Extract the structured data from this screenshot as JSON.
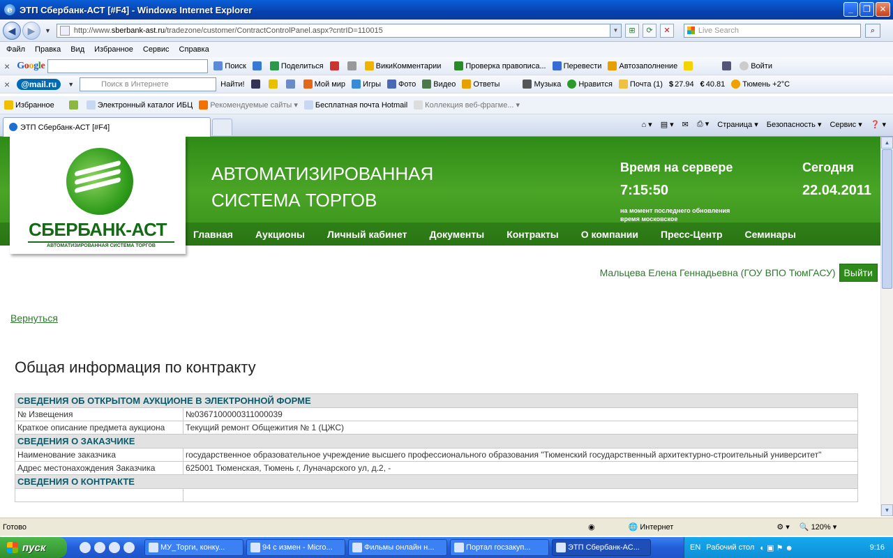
{
  "window": {
    "title": "ЭТП Сбербанк-АСТ [#F4] - Windows Internet Explorer"
  },
  "address": {
    "url_prefix": "http://www.",
    "url_host": "sberbank-ast.ru",
    "url_path": "/tradezone/customer/ContractControlPanel.aspx?cntrID=110015",
    "live_search_placeholder": "Live Search"
  },
  "menu": [
    "Файл",
    "Правка",
    "Вид",
    "Избранное",
    "Сервис",
    "Справка"
  ],
  "google_toolbar": {
    "brand": "Google",
    "items": [
      "Поиск",
      "Поделиться",
      "ВикиКомментарии",
      "Проверка правописа...",
      "Перевести",
      "Автозаполнение",
      "Войти"
    ]
  },
  "mail_toolbar": {
    "brand": "@mail.ru",
    "search_placeholder": "Поиск в Интернете",
    "find": "Найти!",
    "items": [
      "Мой мир",
      "Игры",
      "Фото",
      "Видео",
      "Ответы",
      "Музыка",
      "Нравится",
      "Почта (1)",
      "27.94",
      "40.81",
      "Тюмень +2°C"
    ]
  },
  "favorites": {
    "label": "Избранное",
    "items": [
      "Электронный каталог  ИБЦ",
      "Рекомендуемые сайты",
      "Бесплатная почта Hotmail",
      "Коллекция веб-фрагме..."
    ]
  },
  "tab": {
    "title": "ЭТП Сбербанк-АСТ [#F4]"
  },
  "commandbar": [
    "Страница",
    "Безопасность",
    "Сервис"
  ],
  "site": {
    "logo_brand": "СБЕРБАНК-АСТ",
    "logo_sub": "АВТОМАТИЗИРОВАННАЯ СИСТЕМА ТОРГОВ",
    "title_line1": "АВТОМАТИЗИРОВАННАЯ",
    "title_line2": "СИСТЕМА ТОРГОВ",
    "server_time_label": "Время на сервере",
    "server_time": "7:15:50",
    "server_note_1": "на момент последнего обновления",
    "server_note_2": "время московское",
    "today_label": "Сегодня",
    "today_date": "22.04.2011",
    "nav": [
      "Главная",
      "Аукционы",
      "Личный кабинет",
      "Документы",
      "Контракты",
      "О компании",
      "Пресс-Центр",
      "Семинары"
    ],
    "user": "Мальцева Елена Геннадьевна (ГОУ ВПО ТюмГАСУ)",
    "logout": "Выйти",
    "back": "Вернуться",
    "heading": "Общая информация по контракту"
  },
  "table": {
    "sec1": "СВЕДЕНИЯ ОБ ОТКРЫТОМ АУКЦИОНЕ В ЭЛЕКТРОННОЙ ФОРМЕ",
    "r1k": "№ Извещения",
    "r1v": "№0367100000311000039",
    "r2k": "Краткое описание предмета аукциона",
    "r2v": "Текущий ремонт Общежития № 1 (ЦЖС)",
    "sec2": "СВЕДЕНИЯ О ЗАКАЗЧИКЕ",
    "r3k": "Наименование заказчика",
    "r3v": "государственное образовательное учреждение высшего профессионального образования \"Тюменский государственный архитектурно-строительный университет\"",
    "r4k": "Адрес местонахождения Заказчика",
    "r4v": "625001 Тюменская, Тюмень г, Луначарского ул, д.2, -",
    "sec3": "СВЕДЕНИЯ О КОНТРАКТЕ"
  },
  "status": {
    "left": "Готово",
    "zone": "Интернет",
    "zoom": "120%"
  },
  "taskbar": {
    "start": "пуск",
    "tasks": [
      "МУ_Торги, конку...",
      "94 с измен - Micro...",
      "Фильмы онлайн н...",
      "Портал госзакуп...",
      "ЭТП Сбербанк-АС..."
    ],
    "lang": "EN",
    "desktop": "Рабочий стол",
    "clock": "9:16"
  }
}
